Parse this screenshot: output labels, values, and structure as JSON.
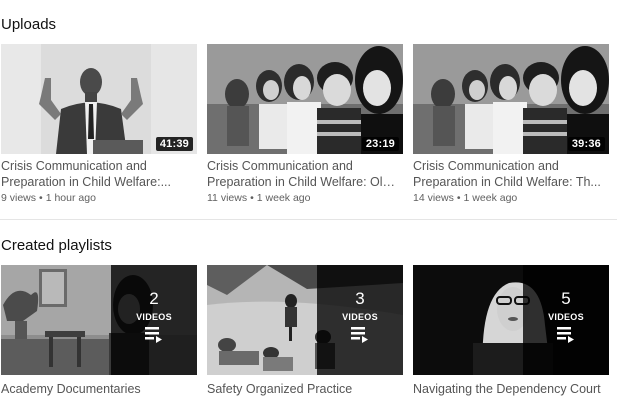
{
  "uploads": {
    "title": "Uploads",
    "videos": [
      {
        "title_line1": "Crisis Communication and",
        "title_line2": "Preparation in Child Welfare:...",
        "views": "9 views",
        "age": "1 hour ago",
        "duration": "41:39"
      },
      {
        "title_line1": "Crisis Communication and",
        "title_line2": "Preparation in Child Welfare: Old...",
        "views": "11 views",
        "age": "1 week ago",
        "duration": "23:19"
      },
      {
        "title_line1": "Crisis Communication and",
        "title_line2": "Preparation in Child Welfare: Th...",
        "views": "14 views",
        "age": "1 week ago",
        "duration": "39:36"
      }
    ],
    "separator": "•"
  },
  "playlists": {
    "title": "Created playlists",
    "items": [
      {
        "title": "Academy Documentaries",
        "count": "2",
        "count_label": "VIDEOS"
      },
      {
        "title": "Safety Organized Practice",
        "count": "3",
        "count_label": "VIDEOS"
      },
      {
        "title": "Navigating the Dependency Court",
        "count": "5",
        "count_label": "VIDEOS"
      }
    ]
  },
  "colors": {
    "text_primary": "#111111",
    "text_secondary": "#606060",
    "overlay": "#000000",
    "divider": "#e5e5e5"
  },
  "icons": [
    "playlist-icon"
  ]
}
